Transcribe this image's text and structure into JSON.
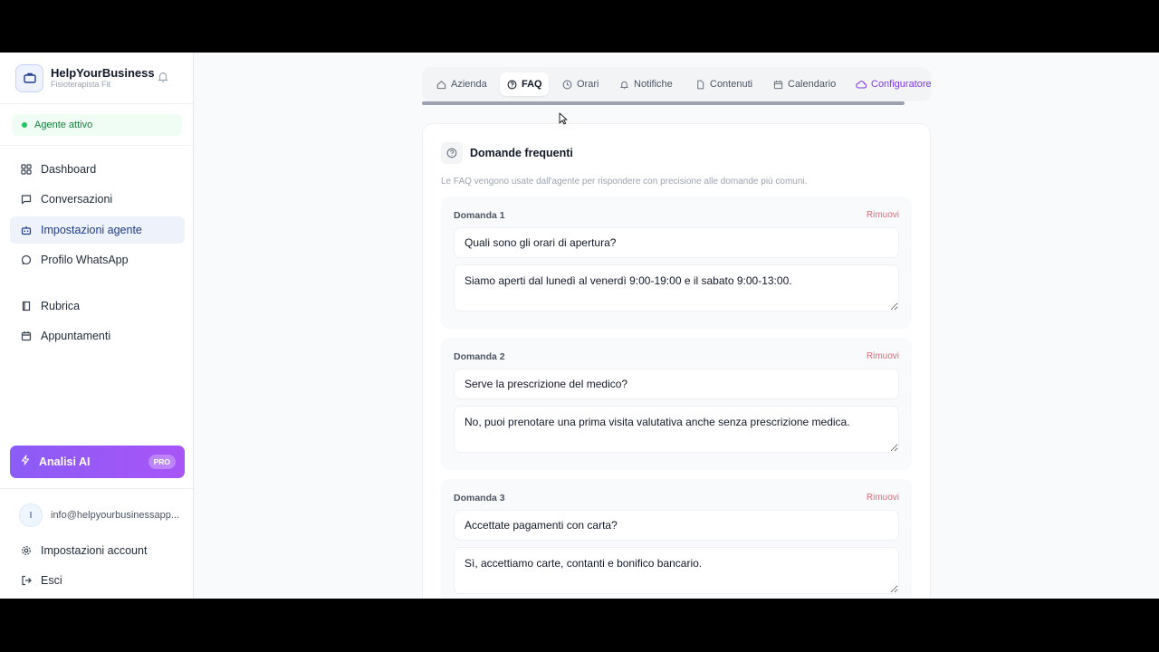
{
  "brand": {
    "name": "HelpYourBusiness",
    "subtitle": "Fisioterapista Fit"
  },
  "status": {
    "label": "Agente attivo",
    "color": "#22c55e"
  },
  "nav": {
    "items": [
      {
        "label": "Dashboard",
        "icon": "grid-icon"
      },
      {
        "label": "Conversazioni",
        "icon": "chat-icon"
      },
      {
        "label": "Impostazioni agente",
        "icon": "robot-icon",
        "active": true
      },
      {
        "label": "Profilo WhatsApp",
        "icon": "whatsapp-icon"
      },
      {
        "label": "Rubrica",
        "icon": "book-icon"
      },
      {
        "label": "Appuntamenti",
        "icon": "calendar-icon"
      }
    ]
  },
  "promo": {
    "label": "Analisi AI",
    "badge": "PRO"
  },
  "user": {
    "initial": "I",
    "email": "info@helpyourbusinessapp..."
  },
  "footer": {
    "settings_label": "Impostazioni account",
    "logout_label": "Esci"
  },
  "tabs": [
    {
      "label": "Azienda",
      "icon": "home-icon"
    },
    {
      "label": "FAQ",
      "icon": "help-circle-icon",
      "active": true
    },
    {
      "label": "Orari",
      "icon": "clock-icon"
    },
    {
      "label": "Notifiche",
      "icon": "bell-icon"
    },
    {
      "label": "Contenuti",
      "icon": "file-icon"
    },
    {
      "label": "Calendario",
      "icon": "calendar-icon"
    },
    {
      "label": "Configuratore",
      "icon": "cloud-icon"
    }
  ],
  "faq_section": {
    "title": "Domande frequenti",
    "description": "Le FAQ vengono usate dall'agente per rispondere con precisione alle domande più comuni.",
    "remove_label": "Rimuovi",
    "items": [
      {
        "label": "Domanda 1",
        "question": "Quali sono gli orari di apertura?",
        "answer": "Siamo aperti dal lunedì al venerdì 9:00-19:00 e il sabato 9:00-13:00."
      },
      {
        "label": "Domanda 2",
        "question": "Serve la prescrizione del medico?",
        "answer": "No, puoi prenotare una prima visita valutativa anche senza prescrizione medica."
      },
      {
        "label": "Domanda 3",
        "question": "Accettate pagamenti con carta?",
        "answer": "Sì, accettiamo carte, contanti e bonifico bancario."
      }
    ]
  },
  "colors": {
    "accent": "#8b5cf6",
    "active_nav_bg": "#eef2fb",
    "remove": "#dc6b7a"
  }
}
